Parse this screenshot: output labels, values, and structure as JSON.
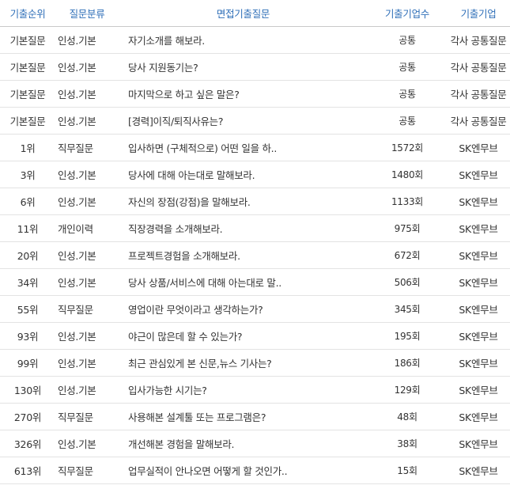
{
  "headers": {
    "rank": "기출순위",
    "category": "질문분류",
    "question": "면접기출질문",
    "count": "기출기업수",
    "company": "기출기업"
  },
  "rows": [
    {
      "rank": "기본질문",
      "category": "인성.기본",
      "question": "자기소개를 해보라.",
      "count": "공통",
      "company": "각사 공통질문"
    },
    {
      "rank": "기본질문",
      "category": "인성.기본",
      "question": "당사 지원동기는?",
      "count": "공통",
      "company": "각사 공통질문"
    },
    {
      "rank": "기본질문",
      "category": "인성.기본",
      "question": "마지막으로 하고 싶은 말은?",
      "count": "공통",
      "company": "각사 공통질문"
    },
    {
      "rank": "기본질문",
      "category": "인성.기본",
      "question": "[경력]이직/퇴직사유는?",
      "count": "공통",
      "company": "각사 공통질문"
    },
    {
      "rank": "1위",
      "category": "직무질문",
      "question": "입사하면 (구체적으로) 어떤 일을 하..",
      "count": "1572회",
      "company": "SK엔무브"
    },
    {
      "rank": "3위",
      "category": "인성.기본",
      "question": "당사에 대해 아는대로 말해보라.",
      "count": "1480회",
      "company": "SK엔무브"
    },
    {
      "rank": "6위",
      "category": "인성.기본",
      "question": "자신의 장점(강점)을 말해보라.",
      "count": "1133회",
      "company": "SK엔무브"
    },
    {
      "rank": "11위",
      "category": "개인이력",
      "question": "직장경력을 소개해보라.",
      "count": "975회",
      "company": "SK엔무브"
    },
    {
      "rank": "20위",
      "category": "인성.기본",
      "question": "프로젝트경험을 소개해보라.",
      "count": "672회",
      "company": "SK엔무브"
    },
    {
      "rank": "34위",
      "category": "인성.기본",
      "question": "당사 상품/서비스에 대해 아는대로 말..",
      "count": "506회",
      "company": "SK엔무브"
    },
    {
      "rank": "55위",
      "category": "직무질문",
      "question": "영업이란 무엇이라고 생각하는가?",
      "count": "345회",
      "company": "SK엔무브"
    },
    {
      "rank": "93위",
      "category": "인성.기본",
      "question": "야근이 많은데 할 수 있는가?",
      "count": "195회",
      "company": "SK엔무브"
    },
    {
      "rank": "99위",
      "category": "인성.기본",
      "question": "최근 관심있게 본 신문,뉴스 기사는?",
      "count": "186회",
      "company": "SK엔무브"
    },
    {
      "rank": "130위",
      "category": "인성.기본",
      "question": "입사가능한 시기는?",
      "count": "129회",
      "company": "SK엔무브"
    },
    {
      "rank": "270위",
      "category": "직무질문",
      "question": "사용해본 설계툴 또는 프로그램은?",
      "count": "48회",
      "company": "SK엔무브"
    },
    {
      "rank": "326위",
      "category": "인성.기본",
      "question": "개선해본 경험을 말해보라.",
      "count": "38회",
      "company": "SK엔무브"
    },
    {
      "rank": "613위",
      "category": "직무질문",
      "question": "업무실적이 안나오면 어떻게 할 것인가..",
      "count": "15회",
      "company": "SK엔무브"
    }
  ]
}
